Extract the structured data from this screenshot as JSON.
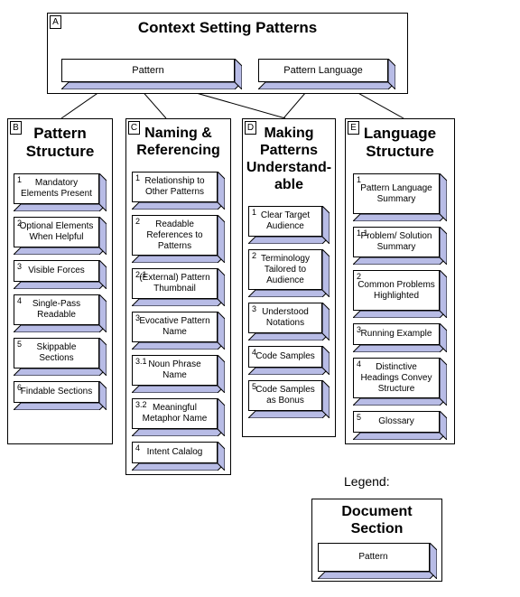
{
  "diagram": {
    "root": {
      "tag": "A",
      "title": "Context Setting Patterns",
      "patterns": [
        {
          "num": "",
          "label": "Pattern"
        },
        {
          "num": "",
          "label": "Pattern Language"
        }
      ]
    },
    "sections": [
      {
        "tag": "B",
        "title": "Pattern Structure",
        "title_lines": [
          "Pattern",
          "Structure"
        ],
        "patterns": [
          {
            "num": "1",
            "label": "Mandatory Elements Present"
          },
          {
            "num": "2",
            "label": "Optional Elements When Helpful"
          },
          {
            "num": "3",
            "label": "Visible Forces"
          },
          {
            "num": "4",
            "label": "Single-Pass Readable"
          },
          {
            "num": "5",
            "label": "Skippable Sections"
          },
          {
            "num": "6",
            "label": "Findable Sections"
          }
        ]
      },
      {
        "tag": "C",
        "title": "Naming & Referencing",
        "title_lines": [
          "Naming &",
          "Referencing"
        ],
        "patterns": [
          {
            "num": "1",
            "label": "Relationship to Other Patterns"
          },
          {
            "num": "2",
            "label": "Readable References to Patterns"
          },
          {
            "num": "2.1",
            "label": "(External) Pattern Thumbnail"
          },
          {
            "num": "3",
            "label": "Evocative Pattern Name"
          },
          {
            "num": "3.1",
            "label": "Noun Phrase Name"
          },
          {
            "num": "3.2",
            "label": "Meaningful Metaphor Name"
          },
          {
            "num": "4",
            "label": "Intent Calalog"
          }
        ]
      },
      {
        "tag": "D",
        "title": "Making Patterns Understand-able",
        "title_lines": [
          "Making",
          "Patterns",
          "Understand-",
          "able"
        ],
        "patterns": [
          {
            "num": "1",
            "label": "Clear Target Audience"
          },
          {
            "num": "2",
            "label": "Terminology Tailored to Audience"
          },
          {
            "num": "3",
            "label": "Understood Notations"
          },
          {
            "num": "4",
            "label": "Code Samples"
          },
          {
            "num": "5",
            "label": "Code Samples as Bonus"
          }
        ]
      },
      {
        "tag": "E",
        "title": "Language Structure",
        "title_lines": [
          "Language",
          "Structure"
        ],
        "patterns": [
          {
            "num": "1",
            "label": "Pattern Language Summary"
          },
          {
            "num": "1.1",
            "label": "Problem/ Solution Summary"
          },
          {
            "num": "2",
            "label": "Common Problems Highlighted"
          },
          {
            "num": "3",
            "label": "Running Example"
          },
          {
            "num": "4",
            "label": "Distinctive Headings Convey Structure"
          },
          {
            "num": "5",
            "label": "Glossary"
          }
        ]
      }
    ],
    "legend": {
      "caption": "Legend:",
      "section_title_lines": [
        "Document",
        "Section"
      ],
      "section_title": "Document Section",
      "pattern_label": "Pattern"
    },
    "colors": {
      "outline": "#000000",
      "fill": "#ffffff",
      "shadow": "#b8bce6",
      "background": "#ffffff"
    }
  }
}
